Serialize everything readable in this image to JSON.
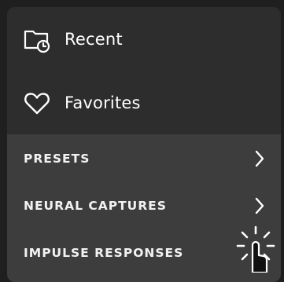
{
  "menu": {
    "top_items": [
      {
        "label": "Recent",
        "icon": "folder-clock-icon"
      },
      {
        "label": "Favorites",
        "icon": "heart-icon"
      }
    ],
    "categories": [
      {
        "label": "PRESETS",
        "icon": "chevron-right-icon"
      },
      {
        "label": "NEURAL CAPTURES",
        "icon": "chevron-right-icon"
      },
      {
        "label": "IMPULSE RESPONSES",
        "icon": "tap-gesture-icon"
      }
    ]
  },
  "colors": {
    "background": "#1f1f1f",
    "panel": "#2d2d2d",
    "category_section": "#3d3d3d",
    "text": "#ffffff"
  }
}
